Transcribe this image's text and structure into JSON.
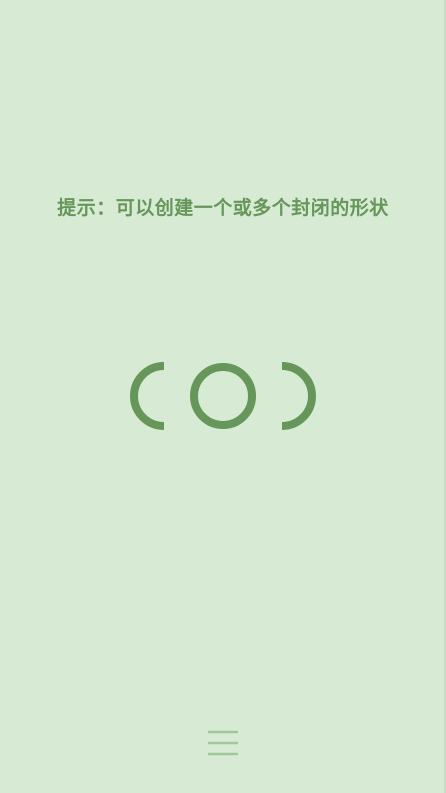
{
  "hint": {
    "text": "提示：可以创建一个或多个封闭的形状"
  },
  "puzzle": {
    "pieces": [
      {
        "name": "left-arc-piece",
        "shape": "left-bracket-arc"
      },
      {
        "name": "center-ring-piece",
        "shape": "ring"
      },
      {
        "name": "right-arc-piece",
        "shape": "right-bracket-arc"
      }
    ]
  },
  "menu": {
    "icon": "hamburger-menu-icon"
  },
  "colors": {
    "background": "#d6ead4",
    "accent": "#66965a",
    "menu_icon": "#9fc798"
  }
}
